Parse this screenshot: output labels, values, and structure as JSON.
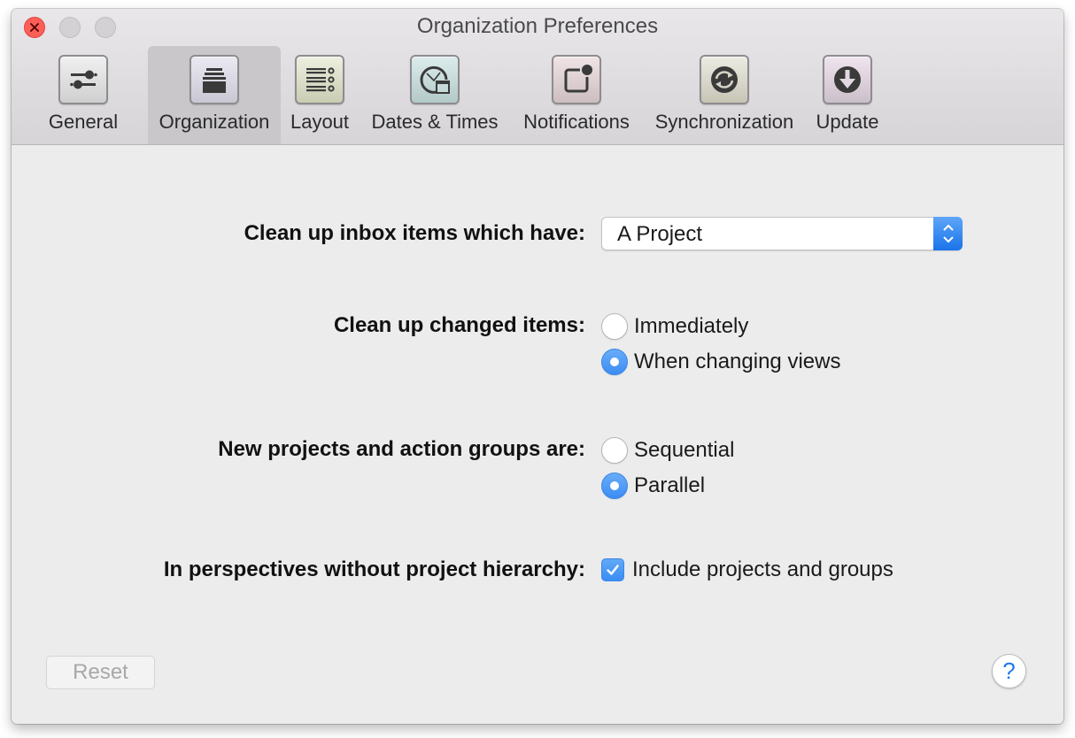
{
  "window": {
    "title": "Organization Preferences"
  },
  "toolbar": {
    "tabs": [
      {
        "label": "General",
        "icon": "sliders-icon",
        "selected": false
      },
      {
        "label": "Organization",
        "icon": "inbox-stack-icon",
        "selected": true
      },
      {
        "label": "Layout",
        "icon": "list-layout-icon",
        "selected": false
      },
      {
        "label": "Dates & Times",
        "icon": "clock-calendar-icon",
        "selected": false
      },
      {
        "label": "Notifications",
        "icon": "notification-badge-icon",
        "selected": false
      },
      {
        "label": "Synchronization",
        "icon": "sync-icon",
        "selected": false
      },
      {
        "label": "Update",
        "icon": "download-arrow-icon",
        "selected": false
      }
    ]
  },
  "settings": {
    "inbox_cleanup": {
      "label": "Clean up inbox items which have:",
      "selected_value": "A Project"
    },
    "changed_items": {
      "label": "Clean up changed items:",
      "options": [
        {
          "label": "Immediately",
          "checked": false
        },
        {
          "label": "When changing views",
          "checked": true
        }
      ]
    },
    "new_projects": {
      "label": "New projects and action groups are:",
      "options": [
        {
          "label": "Sequential",
          "checked": false
        },
        {
          "label": "Parallel",
          "checked": true
        }
      ]
    },
    "perspectives": {
      "label": "In perspectives without project hierarchy:",
      "checkbox_label": "Include projects and groups",
      "checked": true
    }
  },
  "footer": {
    "reset_label": "Reset",
    "help_label": "?"
  },
  "colors": {
    "accent": "#3b8df4",
    "close": "#fc5f57"
  }
}
